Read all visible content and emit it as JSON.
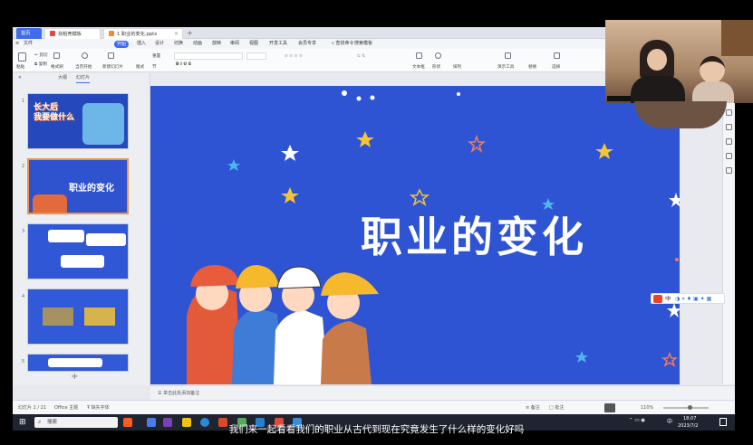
{
  "tabs": {
    "home": "首页",
    "template": "找稻壳模板",
    "doc": "1 职业的变化.pptx",
    "new": "+"
  },
  "menu": {
    "file": "文件",
    "items": [
      "开始",
      "插入",
      "设计",
      "切换",
      "动画",
      "放映",
      "审阅",
      "视图",
      "开发工具",
      "会员专享"
    ],
    "search": "查找命令",
    "search2": "搜索模板"
  },
  "ribbon": {
    "labels": [
      "粘贴",
      "剪切",
      "复制",
      "格式刷",
      "当页开始",
      "新建幻灯片",
      "版式",
      "节",
      "重置",
      "文本框",
      "形状",
      "排列",
      "演示工具",
      "替换",
      "选择"
    ]
  },
  "leftpane": {
    "tab_outline": "大纲",
    "tab_slides": "幻灯片",
    "add": "+"
  },
  "thumbs": [
    {
      "num": "1",
      "title": "长大后\n我要做什么"
    },
    {
      "num": "2",
      "title": "职业的变化"
    },
    {
      "num": "3",
      "title": ""
    },
    {
      "num": "4",
      "title": ""
    },
    {
      "num": "5",
      "title": ""
    }
  ],
  "slide": {
    "title": "职业的变化"
  },
  "notes": {
    "placeholder": "单击此处添加备注"
  },
  "status": {
    "slide_count": "幻灯片 2 / 21",
    "theme": "Office 主题",
    "font_missing": "缺失字体",
    "notes": "备注",
    "comment": "批注",
    "zoom": "110%"
  },
  "taskbar": {
    "search": "搜索",
    "time": "18:07",
    "date": "2023/7/2",
    "ime": "中"
  },
  "subtitle": "我们来一起看看我们的职业从古代到现在究竟发生了什么样的变化好吗",
  "colors": {
    "accent": "#3d6cf0",
    "slide_bg": "#2f54d3",
    "selected_border": "#f0914a"
  }
}
